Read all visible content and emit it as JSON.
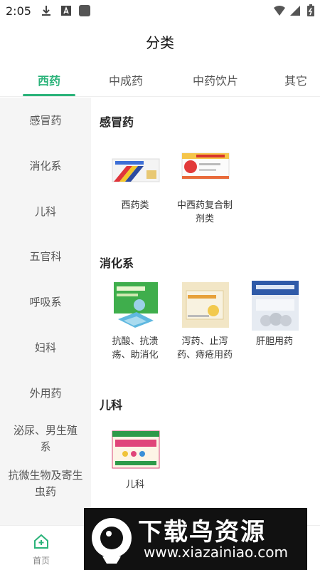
{
  "status_bar": {
    "time": "2:05"
  },
  "header": {
    "title": "分类"
  },
  "tabs": [
    {
      "label": "西药",
      "active": true
    },
    {
      "label": "中成药",
      "active": false
    },
    {
      "label": "中药饮片",
      "active": false
    },
    {
      "label": "其它",
      "active": false
    }
  ],
  "sidebar": {
    "items": [
      {
        "label": "感冒药"
      },
      {
        "label": "消化系"
      },
      {
        "label": "儿科"
      },
      {
        "label": "五官科"
      },
      {
        "label": "呼吸系"
      },
      {
        "label": "妇科"
      },
      {
        "label": "外用药"
      },
      {
        "label": "泌尿、男生殖系"
      },
      {
        "label": "抗微生物及寄生虫药"
      }
    ]
  },
  "sections": [
    {
      "title": "感冒药",
      "items": [
        {
          "label": "西药类"
        },
        {
          "label": "中西药复合制剂类"
        }
      ]
    },
    {
      "title": "消化系",
      "items": [
        {
          "label": "抗酸、抗溃疡、助消化"
        },
        {
          "label": "泻药、止泻药、痔疮用药"
        },
        {
          "label": "肝胆用药"
        }
      ]
    },
    {
      "title": "儿科",
      "items": [
        {
          "label": "儿科"
        }
      ]
    }
  ],
  "bottom_nav": {
    "home_label": "首页"
  },
  "watermark": {
    "title": "下载鸟资源",
    "url": "www.xiazainiao.com"
  },
  "colors": {
    "accent": "#2bb37a",
    "sidebar_bg": "#f5f5f5"
  }
}
